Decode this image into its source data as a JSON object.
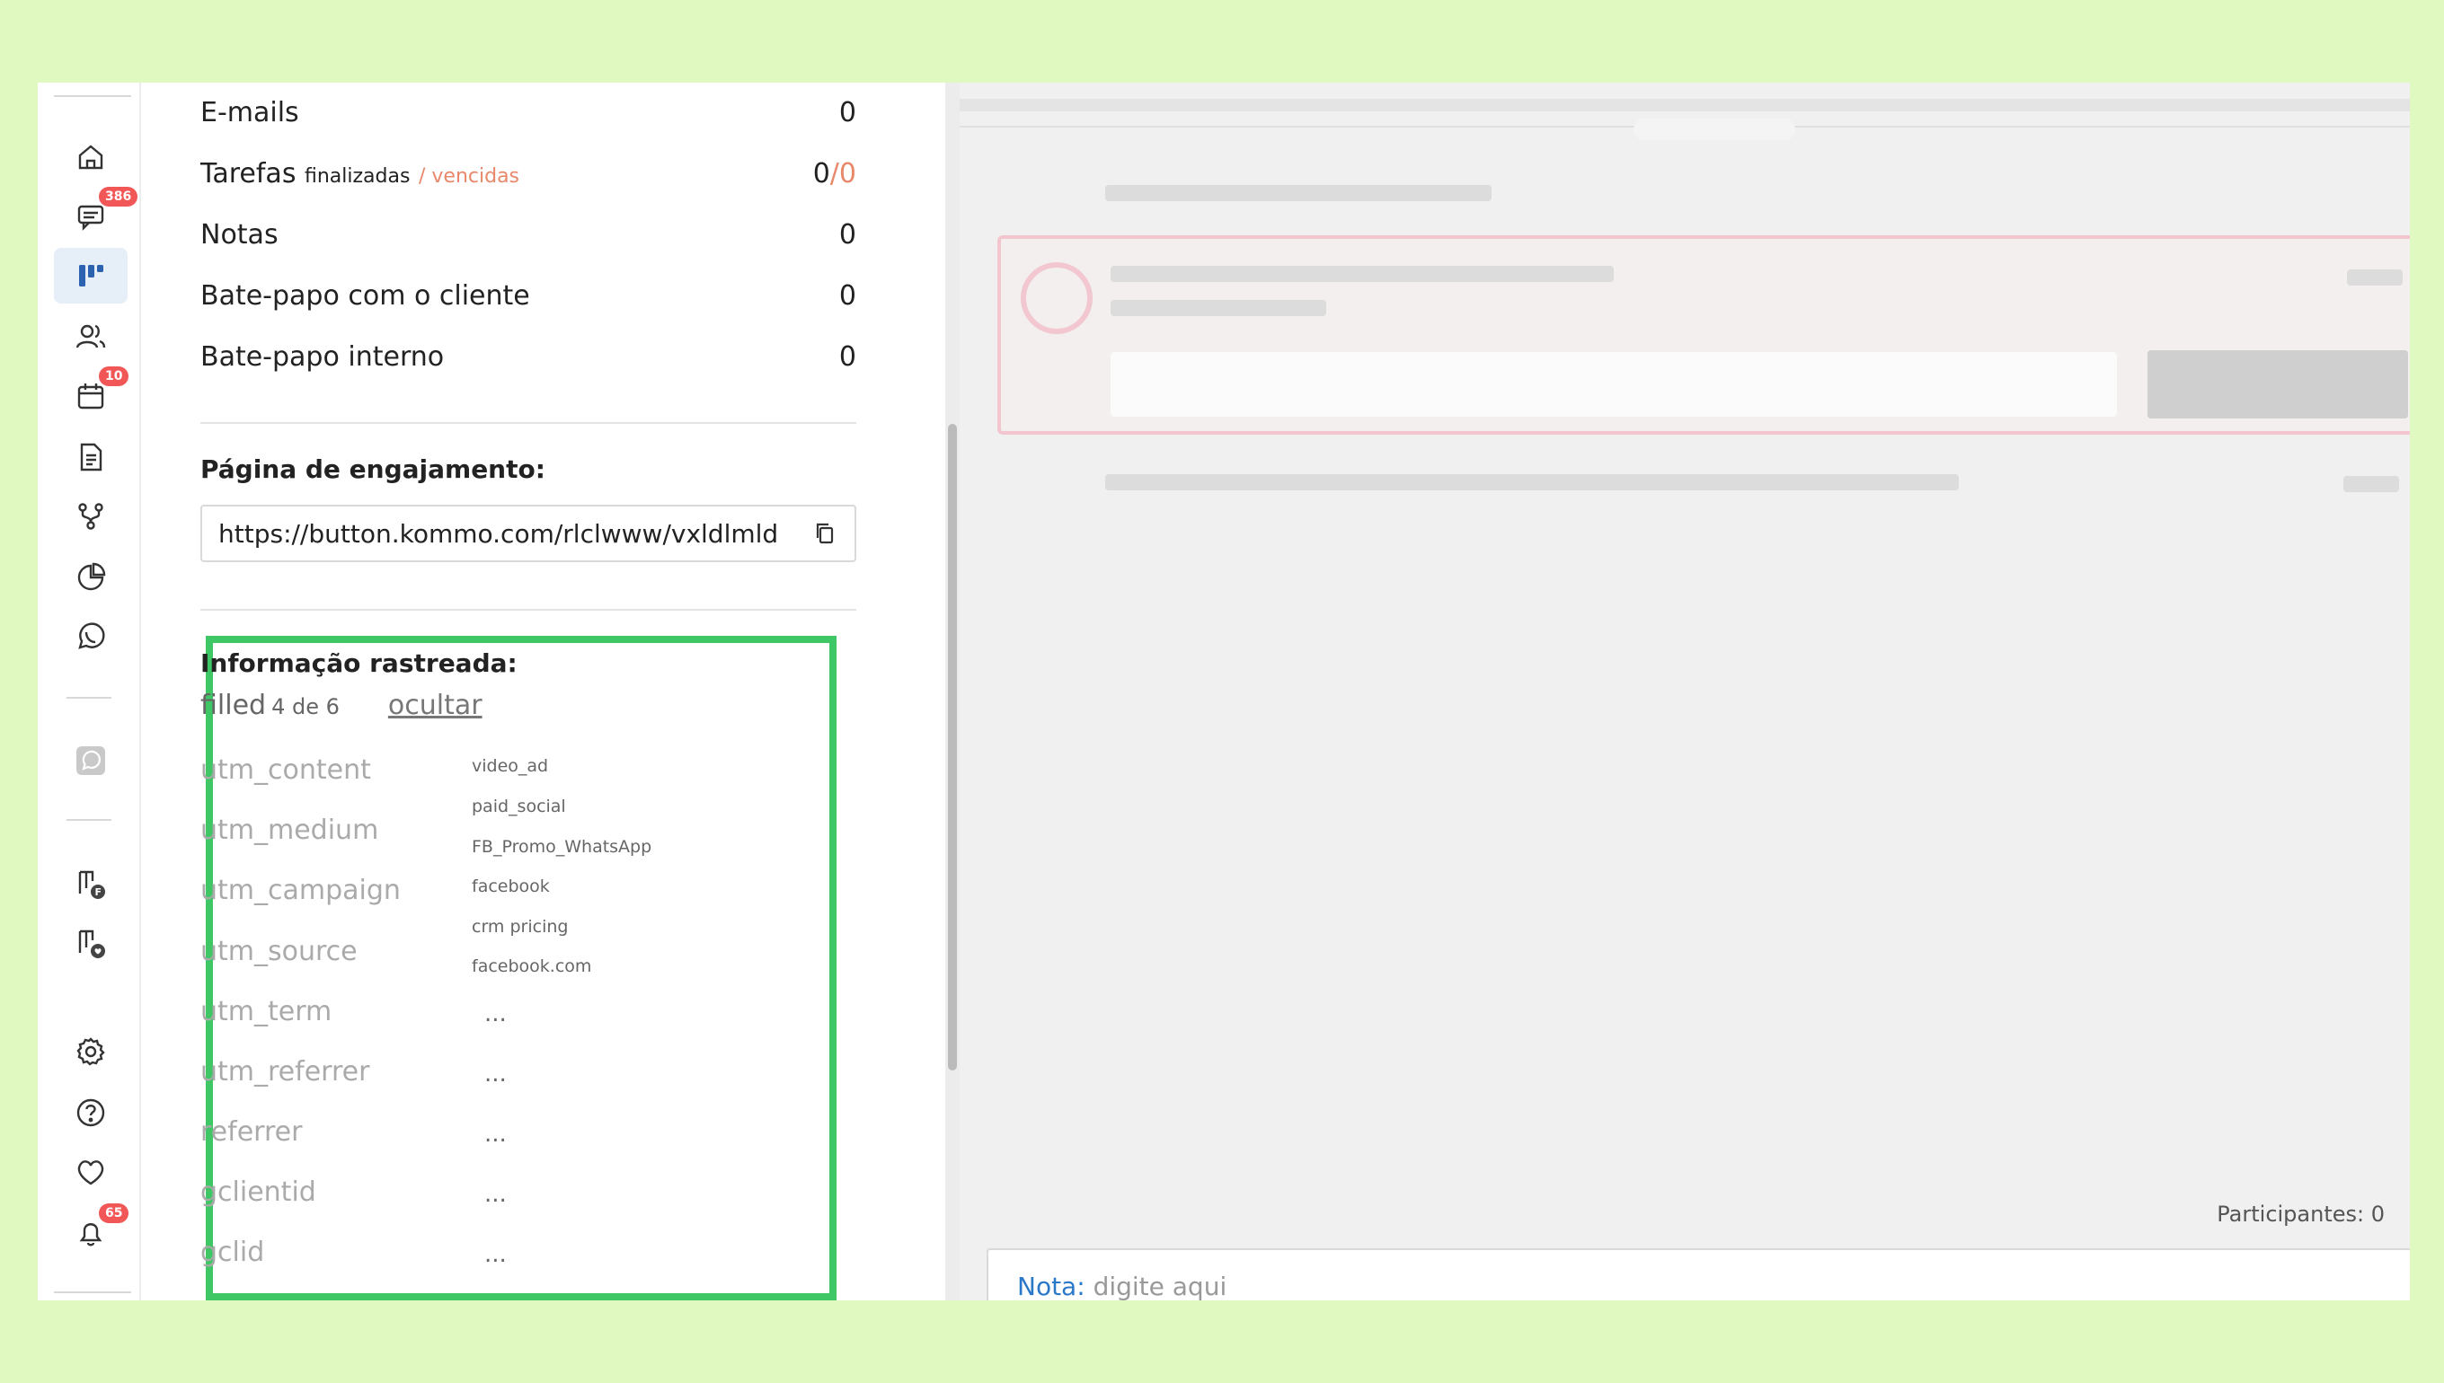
{
  "nav": {
    "badges": {
      "chats": "386",
      "calendar": "10",
      "notifications": "65"
    },
    "accent": "#2c63b0",
    "items": [
      "home-icon",
      "chat-icon",
      "leads-icon",
      "contacts-icon",
      "calendar-icon",
      "document-icon",
      "flow-icon",
      "stats-icon",
      "whatsapp-icon",
      "whatsapp-square-icon",
      "pipeline-f-icon",
      "pipeline-heart-icon",
      "settings-icon",
      "help-icon",
      "heart-icon",
      "bell-icon"
    ]
  },
  "stats": [
    {
      "label": "E-mails",
      "value": "0"
    },
    {
      "label": "Tarefas",
      "sublabel": "finalizadas",
      "sublabel_extra": "/ vencidas",
      "value": "0",
      "value_extra": "/0"
    },
    {
      "label": "Notas",
      "value": "0"
    },
    {
      "label": "Bate-papo com o cliente",
      "value": "0"
    },
    {
      "label": "Bate-papo interno",
      "value": "0"
    }
  ],
  "engagement": {
    "heading": "Página de engajamento:",
    "url": "https://button.kommo.com/rlclwww/vxldlmld"
  },
  "tracked": {
    "heading": "Informação rastreada:",
    "filled_label": "filled",
    "filled_count": "4 de 6",
    "hide_link": "ocultar",
    "fields": [
      "utm_content",
      "utm_medium",
      "utm_campaign",
      "utm_source",
      "utm_term",
      "utm_referrer",
      "referrer",
      "gclientid",
      "gclid"
    ],
    "values": [
      "video_ad",
      "paid_social",
      "FB_Promo_WhatsApp",
      "facebook",
      "crm pricing",
      "facebook.com"
    ],
    "empty": [
      "...",
      "...",
      "...",
      "...",
      "..."
    ]
  },
  "right": {
    "participants": "Participantes: 0",
    "note_label": "Nota:",
    "note_placeholder": "digite aqui"
  },
  "colors": {
    "highlight": "#3fc766",
    "page_bg": "#e0f9c0",
    "badge": "#f25757"
  }
}
